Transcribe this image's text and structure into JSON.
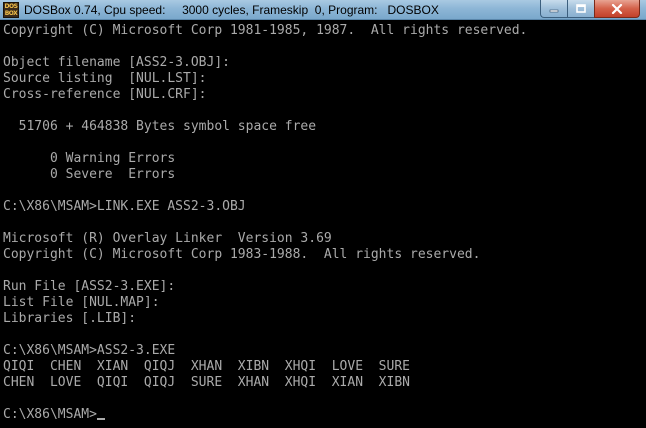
{
  "window": {
    "title": "DOSBox 0.74, Cpu speed:     3000 cycles, Frameskip  0, Program:   DOSBOX",
    "icon_text_top": "DOS",
    "icon_text_bottom": "BOX",
    "icon": "dosbox-icon",
    "buttons": {
      "minimize": "minimize-icon",
      "maximize": "maximize-icon",
      "close": "close-icon"
    }
  },
  "console": {
    "text_color": "#aaaaaa",
    "background": "#000000",
    "lines": [
      "Copyright (C) Microsoft Corp 1981-1985, 1987.  All rights reserved.",
      "",
      "Object filename [ASS2-3.OBJ]:",
      "Source listing  [NUL.LST]:",
      "Cross-reference [NUL.CRF]:",
      "",
      "  51706 + 464838 Bytes symbol space free",
      "",
      "      0 Warning Errors",
      "      0 Severe  Errors",
      "",
      "C:\\X86\\MSAM>LINK.EXE ASS2-3.OBJ",
      "",
      "Microsoft (R) Overlay Linker  Version 3.69",
      "Copyright (C) Microsoft Corp 1983-1988.  All rights reserved.",
      "",
      "Run File [ASS2-3.EXE]:",
      "List File [NUL.MAP]:",
      "Libraries [.LIB]:",
      "",
      "C:\\X86\\MSAM>ASS2-3.EXE",
      "QIQI  CHEN  XIAN  QIQJ  XHAN  XIBN  XHQI  LOVE  SURE",
      "CHEN  LOVE  QIQI  QIQJ  SURE  XHAN  XHQI  XIAN  XIBN",
      ""
    ],
    "prompt": "C:\\X86\\MSAM>"
  }
}
